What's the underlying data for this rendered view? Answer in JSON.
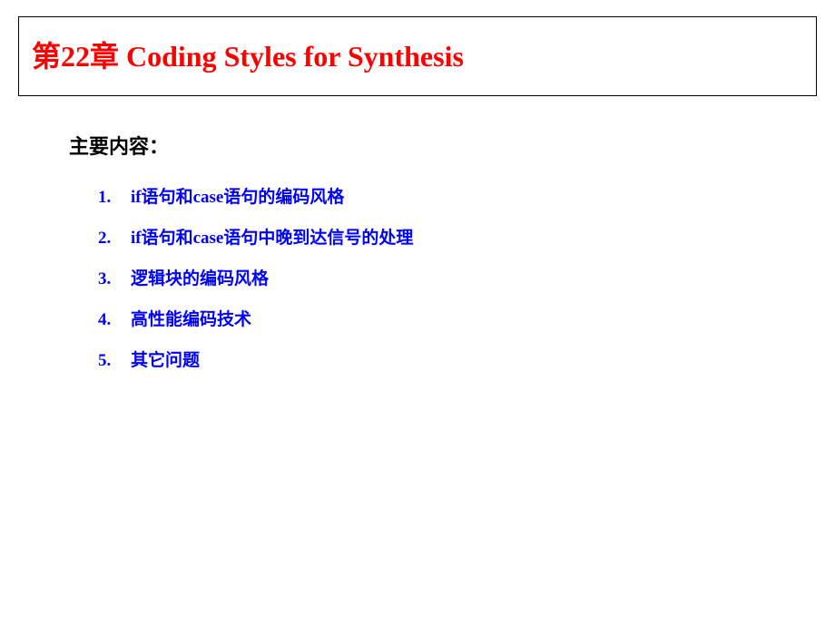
{
  "title": "第22章 Coding Styles for Synthesis",
  "subtitle": "主要内容：",
  "items": [
    {
      "num": "1.",
      "text": "if语句和case语句的编码风格"
    },
    {
      "num": "2.",
      "text": "if语句和case语句中晚到达信号的处理"
    },
    {
      "num": "3.",
      "text": "逻辑块的编码风格"
    },
    {
      "num": "4.",
      "text": "高性能编码技术"
    },
    {
      "num": "5.",
      "text": "其它问题"
    }
  ]
}
